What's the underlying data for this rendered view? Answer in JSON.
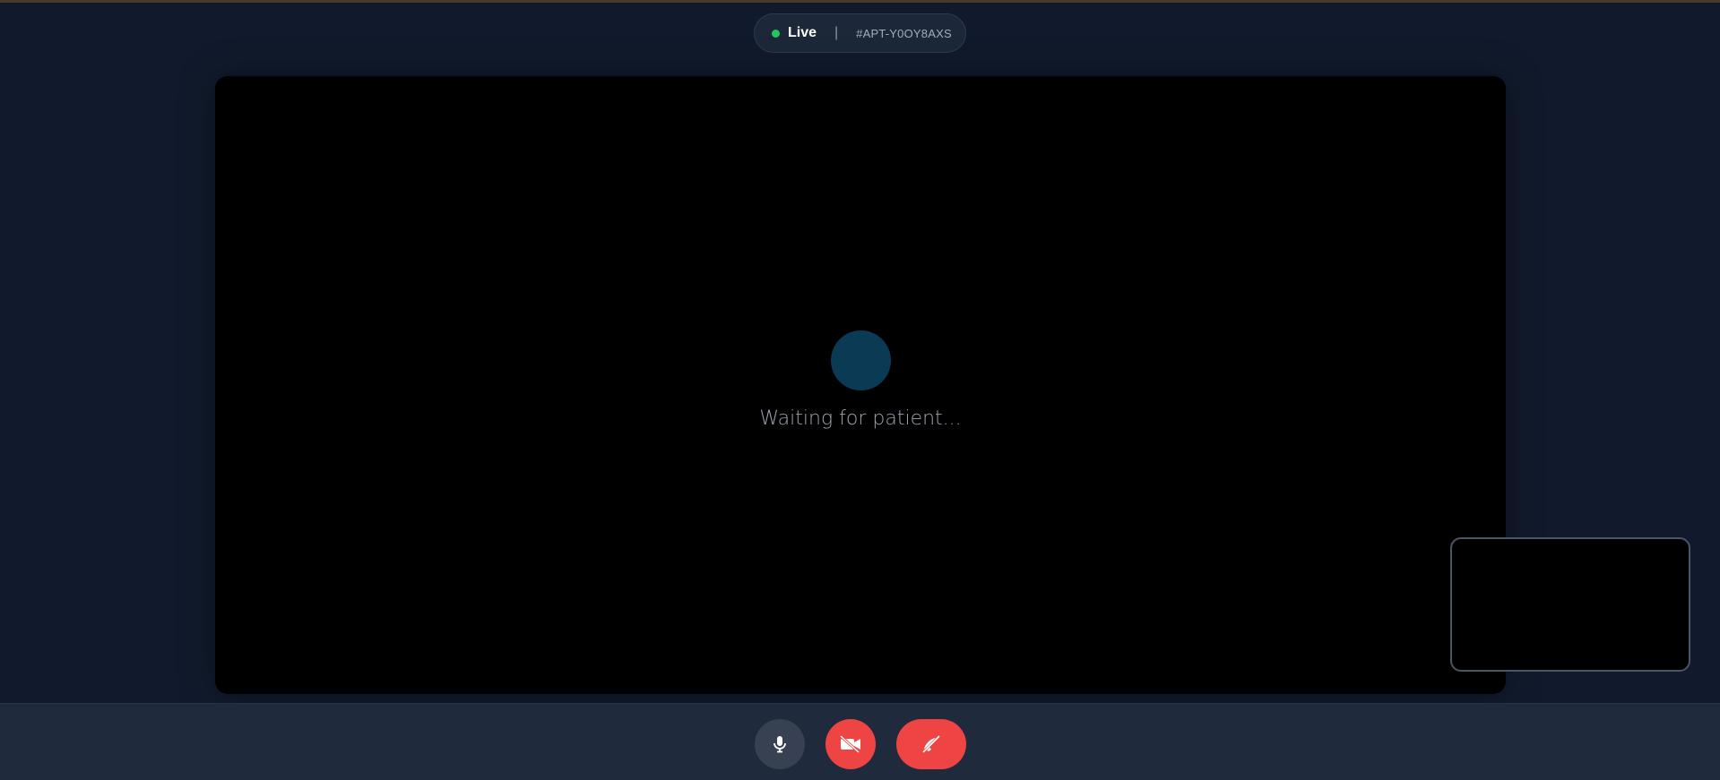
{
  "status": {
    "live_label": "Live",
    "divider": "|",
    "appointment_id": "#APT-Y0OY8AXS",
    "live_color": "#22c55e"
  },
  "remote_video": {
    "waiting_text": "Waiting for patient..."
  },
  "controls": {
    "mic_icon": "microphone-icon",
    "camera_icon": "video-off-icon",
    "end_call_icon": "phone-hangup-icon",
    "danger_color": "#ef4444",
    "neutral_color": "#374151"
  }
}
